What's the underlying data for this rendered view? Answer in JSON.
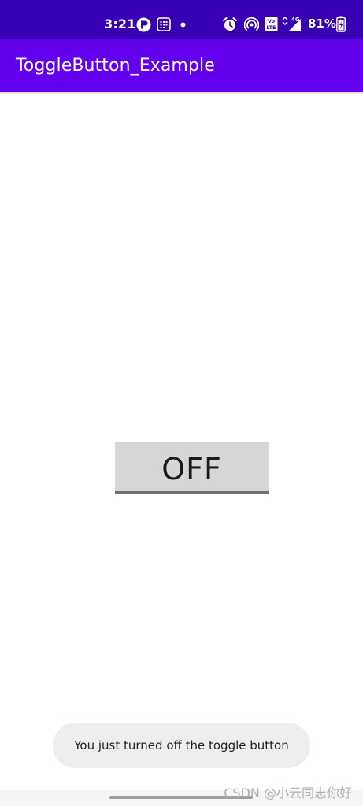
{
  "status_bar": {
    "time": "3:21",
    "battery_percent": "81%",
    "network_label": "4G",
    "volte_label": "Vo LTE",
    "icons": [
      "app-icon",
      "calendar-icon",
      "notification-dot-icon",
      "alarm-icon",
      "hotspot-icon",
      "volte-icon",
      "signal-icon",
      "battery-icon"
    ]
  },
  "app_bar": {
    "title": "ToggleButton_Example"
  },
  "toggle": {
    "label": "OFF",
    "state": "off"
  },
  "toast": {
    "message": "You just turned off the toggle button"
  },
  "watermark": {
    "text": "CSDN @小云同志你好"
  },
  "colors": {
    "status_bar": "#3700b3",
    "app_bar": "#6200ee",
    "toggle_bg": "#d6d7d7",
    "toggle_indicator": "#707070",
    "toast_bg": "#eeeeee"
  }
}
